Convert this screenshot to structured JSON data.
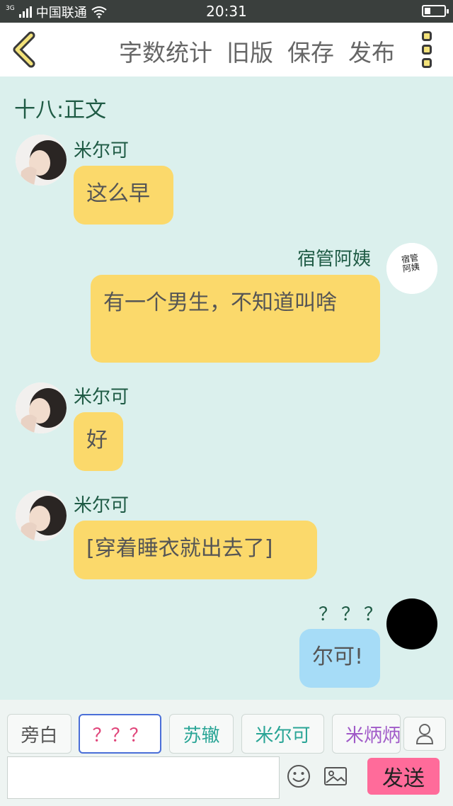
{
  "status_bar": {
    "network": "3G",
    "carrier": "中国联通",
    "time": "20:31",
    "battery_level": 0.3
  },
  "toolbar": {
    "back_icon": "chevron-left-icon",
    "actions": [
      "字数统计",
      "旧版",
      "保存",
      "发布"
    ],
    "more_icon": "more-vertical-icon"
  },
  "chapter_title": "十八:正文",
  "messages": [
    {
      "sender": "米尔可",
      "side": "left",
      "text": "这么早",
      "bubble_color": "#fbd96b",
      "avatar": "mierke-photo"
    },
    {
      "sender": "宿管阿姨",
      "side": "right",
      "text": "有一个男生，不知道叫啥",
      "bubble_color": "#fbd96b",
      "avatar": "susu-ayi-handwriting",
      "avatar_text": "宿管阿姨"
    },
    {
      "sender": "米尔可",
      "side": "left",
      "text": "好",
      "bubble_color": "#fbd96b",
      "avatar": "mierke-photo"
    },
    {
      "sender": "米尔可",
      "side": "left",
      "text": "[穿着睡衣就出去了]",
      "bubble_color": "#fbd96b",
      "avatar": "mierke-photo"
    },
    {
      "sender": "？？？",
      "side": "right",
      "text": "尔可!",
      "bubble_color": "#a6dcf7",
      "avatar": "black-circle"
    }
  ],
  "character_chips": [
    {
      "label": "旁白",
      "color": "#555555",
      "selected": false
    },
    {
      "label": "？？？",
      "color": "#e0457a",
      "selected": true
    },
    {
      "label": "苏辙",
      "color": "#2aa596",
      "selected": false
    },
    {
      "label": "米尔可",
      "color": "#2aa596",
      "selected": false
    },
    {
      "label": "米炳炳",
      "color": "#a05ac8",
      "selected": false
    }
  ],
  "composer": {
    "input_value": "",
    "emoji_icon": "emoji-icon",
    "image_icon": "image-icon",
    "send_label": "发送",
    "person_icon": "person-icon"
  },
  "colors": {
    "background": "#dbf0ed",
    "name_text": "#1f5b45",
    "send_button": "#ff6b9a",
    "accent_yellow": "#f3e27a"
  }
}
